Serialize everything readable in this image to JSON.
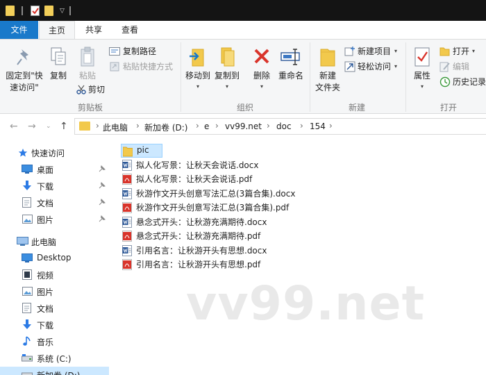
{
  "ribbon_tabs": {
    "file": "文件",
    "home": "主页",
    "share": "共享",
    "view": "查看"
  },
  "ribbon": {
    "clipboard": {
      "pin_line1": "固定到\"快",
      "pin_line2": "速访问\"",
      "copy": "复制",
      "paste": "粘贴",
      "copy_path": "复制路径",
      "paste_shortcut": "粘贴快捷方式",
      "cut": "剪切",
      "group_label": "剪贴板"
    },
    "organize": {
      "move_to": "移动到",
      "copy_to": "复制到",
      "delete": "删除",
      "rename": "重命名",
      "group_label": "组织"
    },
    "new": {
      "new_folder_line1": "新建",
      "new_folder_line2": "文件夹",
      "new_item": "新建项目",
      "easy_access": "轻松访问",
      "group_label": "新建"
    },
    "open": {
      "properties": "属性",
      "open": "打开",
      "edit": "编辑",
      "history": "历史记录",
      "group_label": "打开"
    }
  },
  "address": {
    "crumbs": [
      "此电脑",
      "新加卷 (D:)",
      "e",
      "vv99.net",
      "doc",
      "154"
    ]
  },
  "nav": {
    "quick_access": "快速访问",
    "desktop_pinned": "桌面",
    "downloads_pinned": "下载",
    "documents_pinned": "文档",
    "pictures_pinned": "图片",
    "this_pc": "此电脑",
    "desktop": "Desktop",
    "videos": "视频",
    "pictures": "图片",
    "documents": "文档",
    "downloads": "下载",
    "music": "音乐",
    "system_c": "系统 (C:)",
    "new_volume_d": "新加卷 (D:)"
  },
  "files": [
    {
      "name": "pic",
      "type": "folder"
    },
    {
      "name": "拟人化写景：让秋天会说话.docx",
      "type": "docx"
    },
    {
      "name": "拟人化写景：让秋天会说话.pdf",
      "type": "pdf"
    },
    {
      "name": "秋游作文开头创意写法汇总(3篇合集).docx",
      "type": "docx"
    },
    {
      "name": "秋游作文开头创意写法汇总(3篇合集).pdf",
      "type": "pdf"
    },
    {
      "name": "悬念式开头：让秋游充满期待.docx",
      "type": "docx"
    },
    {
      "name": "悬念式开头：让秋游充满期待.pdf",
      "type": "pdf"
    },
    {
      "name": "引用名言：让秋游开头有思想.docx",
      "type": "docx"
    },
    {
      "name": "引用名言：让秋游开头有思想.pdf",
      "type": "pdf"
    }
  ],
  "watermark": "vv99.net",
  "colors": {
    "accent": "#1979ca",
    "selection": "#cce8ff",
    "folder": "#f2c94c",
    "pdf": "#d9342b",
    "docx": "#2b5797"
  }
}
